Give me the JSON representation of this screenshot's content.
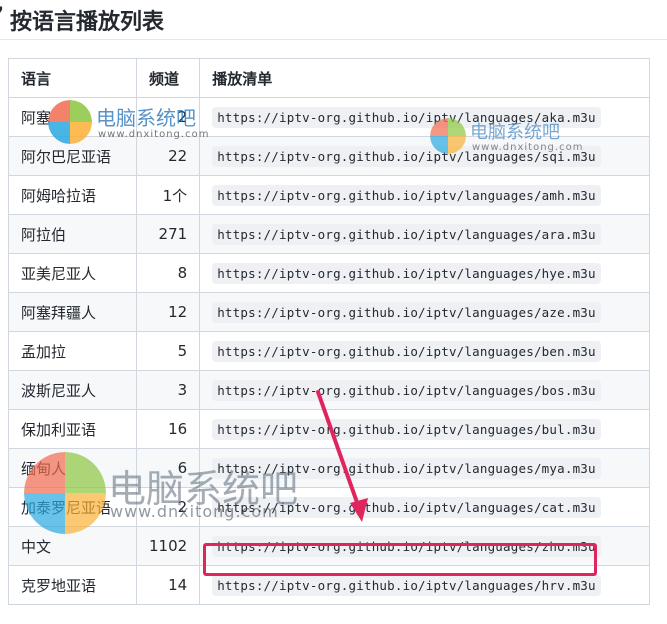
{
  "heading": {
    "text": "按语言播放列表"
  },
  "table": {
    "headers": {
      "language": "语言",
      "channels": "频道",
      "playlist": "播放清单"
    },
    "rows": [
      {
        "language": "阿塞",
        "channels": "2",
        "playlist": "https://iptv-org.github.io/iptv/languages/aka.m3u"
      },
      {
        "language": "阿尔巴尼亚语",
        "channels": "22",
        "playlist": "https://iptv-org.github.io/iptv/languages/sqi.m3u"
      },
      {
        "language": "阿姆哈拉语",
        "channels": "1个",
        "playlist": "https://iptv-org.github.io/iptv/languages/amh.m3u"
      },
      {
        "language": "阿拉伯",
        "channels": "271",
        "playlist": "https://iptv-org.github.io/iptv/languages/ara.m3u"
      },
      {
        "language": "亚美尼亚人",
        "channels": "8",
        "playlist": "https://iptv-org.github.io/iptv/languages/hye.m3u"
      },
      {
        "language": "阿塞拜疆人",
        "channels": "12",
        "playlist": "https://iptv-org.github.io/iptv/languages/aze.m3u"
      },
      {
        "language": "孟加拉",
        "channels": "5",
        "playlist": "https://iptv-org.github.io/iptv/languages/ben.m3u"
      },
      {
        "language": "波斯尼亚人",
        "channels": "3",
        "playlist": "https://iptv-org.github.io/iptv/languages/bos.m3u"
      },
      {
        "language": "保加利亚语",
        "channels": "16",
        "playlist": "https://iptv-org.github.io/iptv/languages/bul.m3u"
      },
      {
        "language": "缅甸人",
        "channels": "6",
        "playlist": "https://iptv-org.github.io/iptv/languages/mya.m3u"
      },
      {
        "language": "加泰罗尼亚语",
        "channels": "2",
        "playlist": "https://iptv-org.github.io/iptv/languages/cat.m3u"
      },
      {
        "language": "中文",
        "channels": "1102",
        "playlist": "https://iptv-org.github.io/iptv/languages/zho.m3u"
      },
      {
        "language": "克罗地亚语",
        "channels": "14",
        "playlist": "https://iptv-org.github.io/iptv/languages/hrv.m3u"
      }
    ]
  },
  "annotation": {
    "box_color": "#e0245e",
    "arrow_color": "#e0245e"
  },
  "watermark": {
    "brand": "电脑系统吧",
    "url": "www.dnxitong.com"
  },
  "colors": {
    "border": "#d0d7de",
    "stripe": "#f6f8fa",
    "code_bg": "#eef0f3",
    "watermark_blue": "#1f6fb8"
  }
}
